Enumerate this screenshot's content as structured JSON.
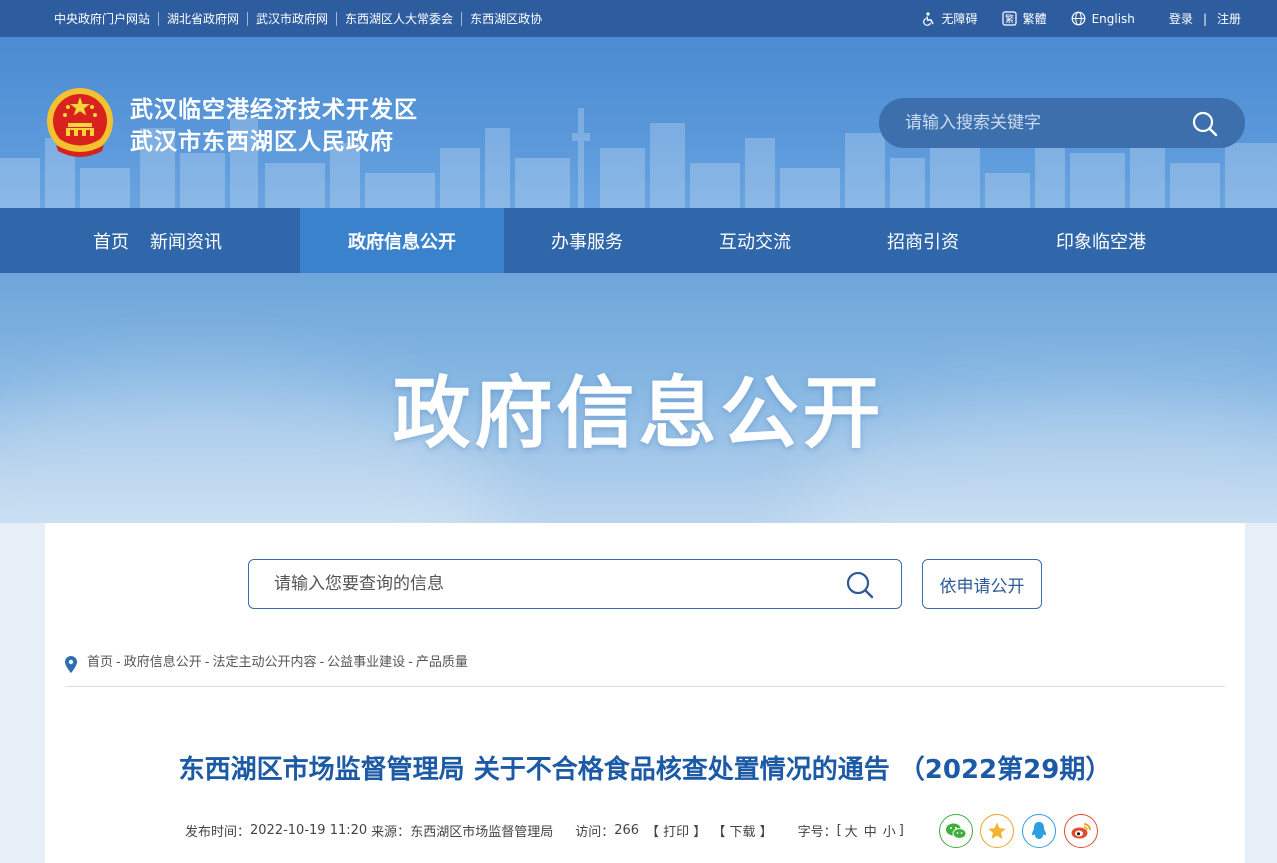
{
  "topbar": {
    "links": [
      "中央政府门户网站",
      "湖北省政府网",
      "武汉市政府网",
      "东西湖区人大常委会",
      "东西湖区政协"
    ],
    "accessibility": "无障碍",
    "traditional": "繁體",
    "english": "English",
    "login": "登录",
    "separator": "|",
    "register": "注册"
  },
  "header": {
    "title_line1": "武汉临空港经济技术开发区",
    "title_line2": "武汉市东西湖区人民政府",
    "search_placeholder": "请输入搜索关键字"
  },
  "nav": {
    "items": [
      "首页",
      "新闻资讯",
      "政府信息公开",
      "办事服务",
      "互动交流",
      "招商引资",
      "印象临空港"
    ],
    "active_index": 2
  },
  "banner": {
    "title": "政府信息公开"
  },
  "content": {
    "search_placeholder": "请输入您要查询的信息",
    "apply_button": "依申请公开",
    "breadcrumb": [
      "首页",
      "政府信息公开",
      "法定主动公开内容",
      "公益事业建设",
      "产品质量"
    ],
    "breadcrumb_sep": "-",
    "article_title": "东西湖区市场监督管理局 关于不合格食品核查处置情况的通告 （2022第29期）",
    "meta": {
      "publish_label": "发布时间：",
      "publish_time": "2022-10-19 11:20",
      "source_label": "来源：",
      "source": "东西湖区市场监督管理局",
      "visits_label": "访问：",
      "visits": "266",
      "print": "【 打印 】",
      "download": "【 下载 】",
      "fontsize_label": "字号：",
      "fontsize_open": "[",
      "fontsize_large": "大",
      "fontsize_medium": "中",
      "fontsize_small": "小",
      "fontsize_close": "]"
    }
  },
  "colors": {
    "topbar": "#2e5d9f",
    "nav": "#2f67aa",
    "nav_active": "#3a83cc",
    "title_blue": "#1d5aa5",
    "wechat": "#3fae3a",
    "favorite": "#e9a52a",
    "qq": "#2d9fe0",
    "weibo": "#e34b2f"
  }
}
